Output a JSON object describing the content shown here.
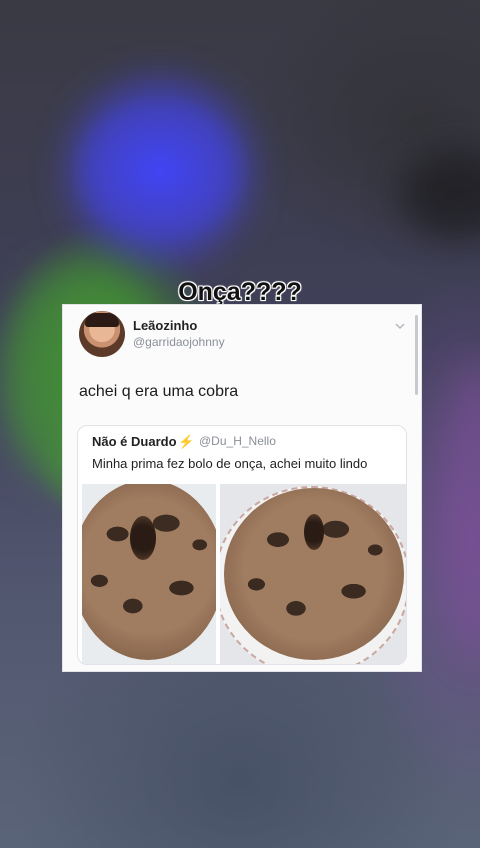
{
  "caption": "Onça????",
  "tweet": {
    "display_name": "Leãozinho",
    "handle": "@garridaojohnny",
    "text": "achei q era uma cobra",
    "quote": {
      "display_name": "Não é Duardo",
      "badge_icon": "lightning-bolt-icon",
      "badge_glyph": "⚡",
      "handle": "@Du_H_Nello",
      "text": "Minha prima fez bolo de onça, achei muito lindo"
    }
  },
  "colors": {
    "caption_text": "#111111",
    "card_background": "#fbfbfc",
    "secondary_text": "#8a8f98",
    "bolt": "#f3c234"
  }
}
